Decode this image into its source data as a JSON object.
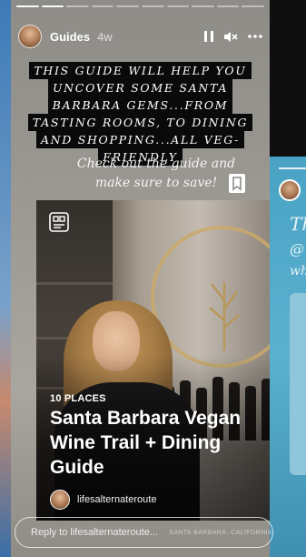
{
  "story": {
    "username": "Guides",
    "time_ago": "4w",
    "progress": {
      "total": 10,
      "current": 2
    }
  },
  "headline_lines": [
    "THIS GUIDE WILL HELP YOU",
    "UNCOVER SOME SANTA",
    "BARBARA GEMS...FROM",
    "TASTING ROOMS, TO DINING",
    "AND SHOPPING...ALL VEG-",
    "FRIENDLY"
  ],
  "cta_lines": [
    "Check out the guide and",
    "make sure to save!"
  ],
  "guide_card": {
    "places_label": "10 PLACES",
    "title": "Santa Barbara Vegan Wine Trail + Dining Guide",
    "author": "lifesalternateroute"
  },
  "reply": {
    "placeholder": "Reply to lifesalternateroute...",
    "location_tag": "SANTA BARBARA, CALIFORNIA"
  },
  "icons": {
    "pause": "pause-icon",
    "mute": "mute-icon",
    "more": "more-icon",
    "bookmark": "bookmark-icon",
    "guide": "guide-icon"
  },
  "next_story_peek": {
    "text_fragments": [
      "Th",
      "@",
      "wh"
    ]
  }
}
